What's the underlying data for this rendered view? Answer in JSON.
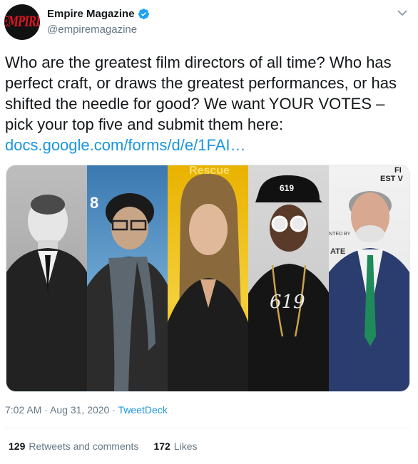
{
  "user": {
    "avatar_text": "EMPIRE",
    "display_name": "Empire Magazine",
    "handle": "@empiremagazine",
    "verified": true
  },
  "tweet": {
    "text": "Who are the greatest film directors of all time? Who has perfect craft, or draws the greatest performances, or has shifted the needle for good? We want YOUR VOTES – pick your top five and submit them here: ",
    "link_text": "docs.google.com/forms/d/e/1FAI…"
  },
  "media": {
    "panel_texts": {
      "p2_backdrop": "8",
      "p3_backdrop": "Rescue",
      "p4_cap": "619",
      "p4_shirt": "619",
      "p5_backdrop_top": "FI",
      "p5_backdrop_line2": "EST V",
      "p5_backdrop_line3": "NTED BY",
      "p5_backdrop_line4": "ATE"
    }
  },
  "footer": {
    "time": "7:02 AM",
    "separator1": " · ",
    "date": "Aug 31, 2020",
    "separator2": " · ",
    "source": "TweetDeck"
  },
  "stats": {
    "retweets_count": "129",
    "retweets_label": "Retweets and comments",
    "likes_count": "172",
    "likes_label": "Likes"
  },
  "colors": {
    "link": "#1b95e0",
    "secondary_text": "#657786",
    "verified": "#1da1f2",
    "avatar_text": "#e0141e"
  }
}
